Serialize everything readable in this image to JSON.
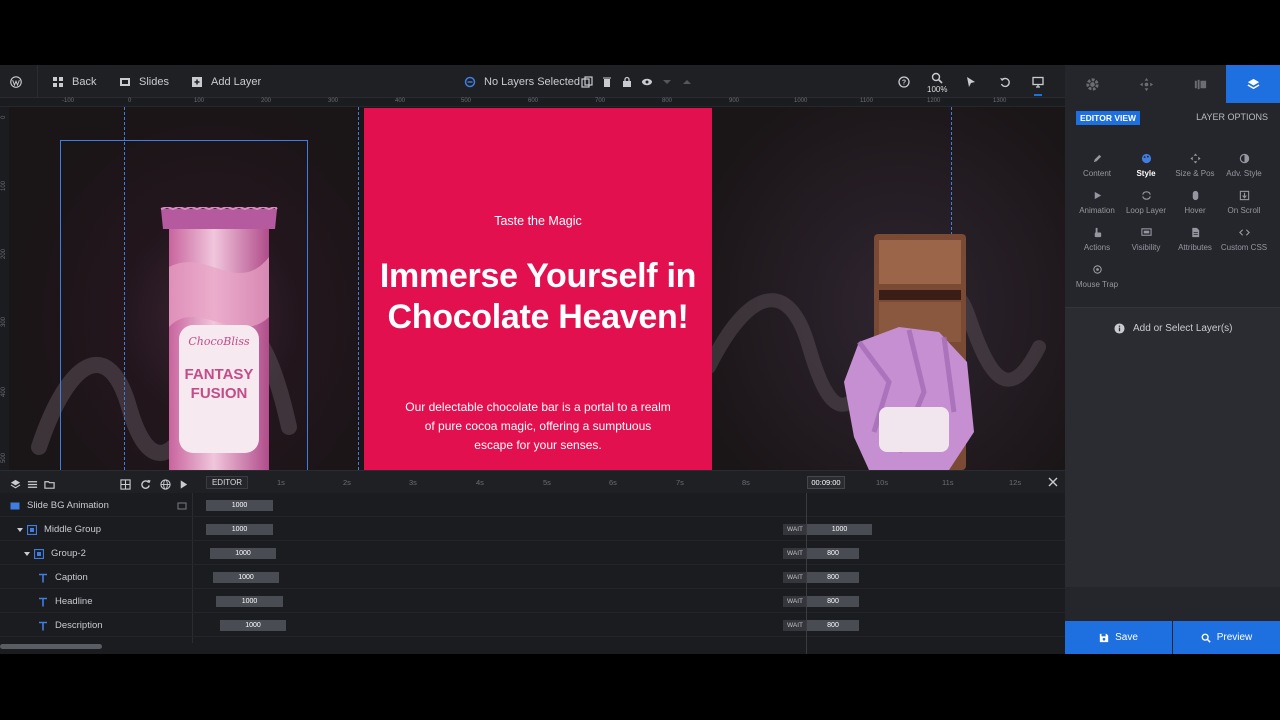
{
  "colors": {
    "accent": "#1e6fe0",
    "slide_pink": "#e2104f",
    "panel": "#25262b",
    "toolbar": "#1f2024"
  },
  "toolbar": {
    "back_label": "Back",
    "slides_label": "Slides",
    "add_layer_label": "Add Layer",
    "layers_status": "No Layers Selected",
    "zoom_value": "100%"
  },
  "ruler": {
    "h_ticks": [
      "-100",
      "0",
      "100",
      "200",
      "300",
      "400",
      "500",
      "600",
      "700",
      "800",
      "900",
      "1000",
      "1100",
      "1200",
      "1300"
    ],
    "v_ticks": [
      "0",
      "100",
      "200",
      "300",
      "400",
      "500"
    ]
  },
  "slide": {
    "caption": "Taste the Magic",
    "headline": "Immerse Yourself in Chocolate Heaven!",
    "description": "Our delectable chocolate bar is a portal to a realm of pure cocoa magic, offering a sumptuous escape for your senses.",
    "product_brand": "ChocoBliss",
    "product_line1": "FANTASY",
    "product_line2": "FUSION"
  },
  "right_panel": {
    "editor_view": "EDITOR VIEW",
    "layer_options": "LAYER OPTIONS",
    "options": [
      {
        "label": "Content"
      },
      {
        "label": "Style"
      },
      {
        "label": "Size & Pos"
      },
      {
        "label": "Adv. Style"
      },
      {
        "label": "Animation"
      },
      {
        "label": "Loop Layer"
      },
      {
        "label": "Hover"
      },
      {
        "label": "On Scroll"
      },
      {
        "label": "Actions"
      },
      {
        "label": "Visibility"
      },
      {
        "label": "Attributes"
      },
      {
        "label": "Custom CSS"
      },
      {
        "label": "Mouse Trap"
      }
    ],
    "active_option": "Style",
    "empty_message": "Add or Select Layer(s)",
    "save_label": "Save",
    "preview_label": "Preview"
  },
  "timeline": {
    "editor_tag": "EDITOR",
    "time_marks": [
      "1s",
      "2s",
      "3s",
      "4s",
      "5s",
      "6s",
      "7s",
      "8s",
      "10s",
      "11s",
      "12s"
    ],
    "current_time": "00:09:00",
    "rows": [
      {
        "label": "Slide BG Animation",
        "in": "1000"
      },
      {
        "label": "Middle Group",
        "in": "1000",
        "wait": "WAIT",
        "out": "1000"
      },
      {
        "label": "Group-2",
        "in": "1000",
        "wait": "WAIT",
        "out": "800"
      },
      {
        "label": "Caption",
        "in": "1000",
        "wait": "WAIT",
        "out": "800"
      },
      {
        "label": "Headline",
        "in": "1000",
        "wait": "WAIT",
        "out": "800"
      },
      {
        "label": "Description",
        "in": "1000",
        "wait": "WAIT",
        "out": "800"
      }
    ]
  }
}
